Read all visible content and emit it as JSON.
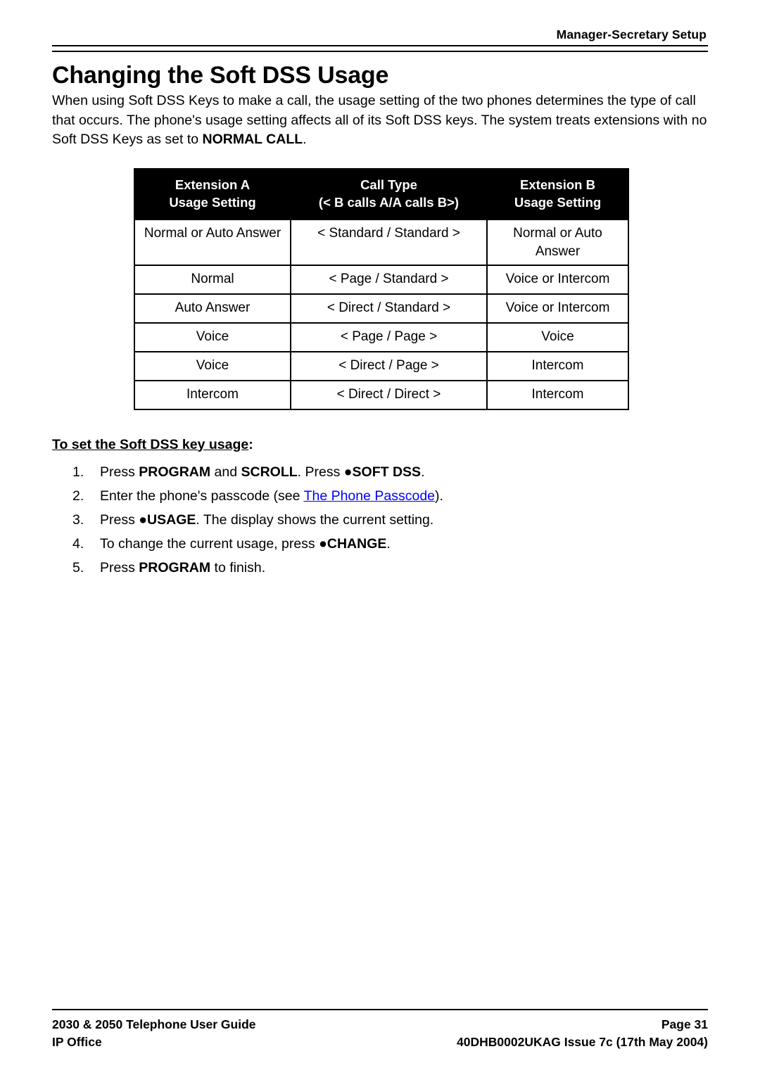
{
  "header": {
    "running_title": "Manager-Secretary Setup"
  },
  "title": "Changing the Soft DSS Usage",
  "intro": {
    "part1": "When using Soft DSS Keys to make a call, the usage setting of the two phones determines the type of call that occurs. The phone's usage setting affects all of its Soft DSS keys. The system treats extensions with no Soft DSS Keys as set to ",
    "emphasis": "NORMAL CALL",
    "part2": "."
  },
  "table": {
    "headers": [
      {
        "line1": "Extension A",
        "line2": "Usage Setting"
      },
      {
        "line1": "Call Type",
        "line2": "(< B calls A/A calls B>)"
      },
      {
        "line1": "Extension B",
        "line2": "Usage Setting"
      }
    ],
    "rows": [
      {
        "ext_a": "Normal or Auto Answer",
        "call_type": "< Standard / Standard >",
        "ext_b": "Normal or Auto Answer"
      },
      {
        "ext_a": "Normal",
        "call_type": "< Page / Standard >",
        "ext_b": "Voice or Intercom"
      },
      {
        "ext_a": "Auto Answer",
        "call_type": "< Direct / Standard >",
        "ext_b": "Voice or Intercom"
      },
      {
        "ext_a": "Voice",
        "call_type": "< Page / Page >",
        "ext_b": "Voice"
      },
      {
        "ext_a": "Voice",
        "call_type": "< Direct / Page >",
        "ext_b": "Intercom"
      },
      {
        "ext_a": "Intercom",
        "call_type": "< Direct / Direct >",
        "ext_b": "Intercom"
      }
    ]
  },
  "procedure": {
    "heading_underlined": "To set the Soft DSS key usage",
    "heading_tail": ":",
    "steps": [
      {
        "s1": "Press ",
        "k1": "PROGRAM",
        "s2": " and ",
        "k2": "SCROLL",
        "s3": ". Press ",
        "k3": "●SOFT DSS",
        "s4": "."
      },
      {
        "s1": "Enter the phone's passcode (see ",
        "link": "The Phone Passcode",
        "s2": ")."
      },
      {
        "s1": "Press ",
        "k1": "●USAGE",
        "s2": ". The display shows the current setting."
      },
      {
        "s1": "To change the current usage, press ",
        "k1": "●CHANGE",
        "s2": "."
      },
      {
        "s1": "Press ",
        "k1": "PROGRAM",
        "s2": " to finish."
      }
    ]
  },
  "footer": {
    "left_line1": "2030 & 2050 Telephone User Guide",
    "left_line2": "IP Office",
    "right_line1": "Page 31",
    "right_line2": "40DHB0002UKAG Issue 7c (17th May 2004)"
  },
  "colors": {
    "link": "#0000FF",
    "header_band": "#000000",
    "text": "#000000"
  }
}
